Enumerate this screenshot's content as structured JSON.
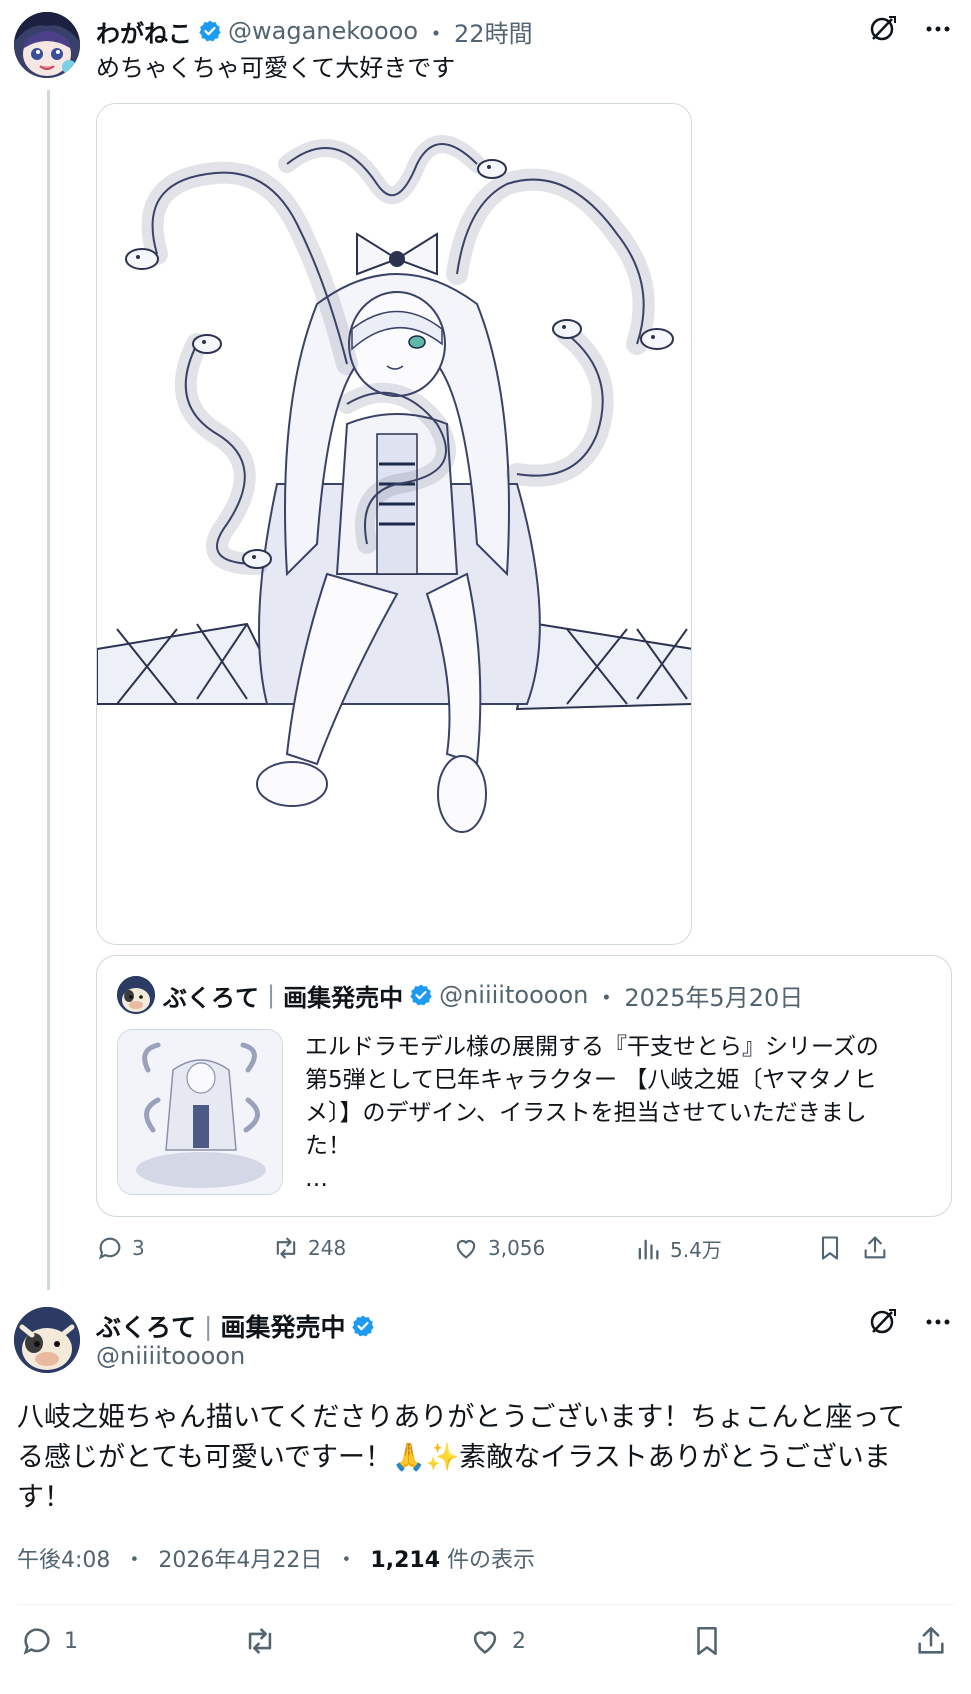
{
  "tweet": {
    "author_name": "わがねこ",
    "handle": "@waganekoooo",
    "separator": "・",
    "time": "22時間",
    "text": "めちゃくちゃ可愛くて大好きです",
    "actions": {
      "reply_count": "3",
      "retweet_count": "248",
      "like_count": "3,056",
      "views_count": "5.4万"
    }
  },
  "quote": {
    "author_name": "ぶくろて",
    "author_suffix": "画集発売中",
    "handle": "@niiiitoooon",
    "date": "2025年5月20日",
    "lines": [
      "エルドラモデル様の展開する『干支せとら』シリーズの",
      "第5弾として巳年キャラクター 【八岐之姫〔ヤマタノヒ",
      "メ〕】のデザイン、イラストを担当させていただきまし",
      "た！"
    ],
    "more": "…"
  },
  "reply": {
    "author_name": "ぶくろて",
    "author_suffix": "画集発売中",
    "handle": "@niiiitoooon",
    "lines": [
      "八岐之姫ちゃん描いてくださりありがとうございます！ちょこんと座って",
      "る感じがとても可愛いですー！🙏✨素敵なイラストありがとうございま",
      "す！"
    ],
    "time": "午後4:08",
    "date": "2026年4月22日",
    "views_number": "1,214",
    "views_label": "件の表示",
    "reply_count": "1",
    "like_count": "2"
  },
  "colors": {
    "text": "#0f1419",
    "muted": "#536471",
    "verified": "#1d9bf0",
    "border": "#cfd9de"
  }
}
